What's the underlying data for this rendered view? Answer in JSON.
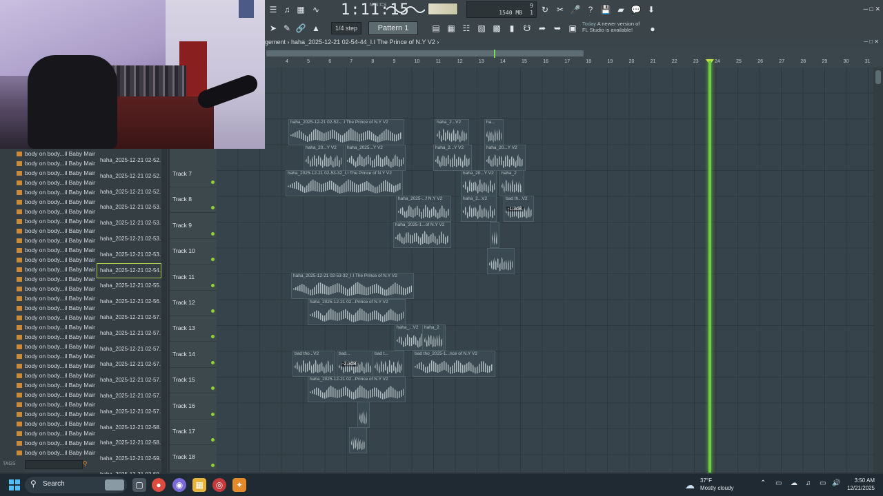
{
  "toolbar": {
    "time": "1:11:15",
    "time_unit": "M:S:CS",
    "cpu_value": "9",
    "memory": "1540 MB",
    "cpu_count": "1",
    "snap": "1/4 step",
    "pattern": "Pattern 1",
    "news_date": "Today",
    "news_text": "A newer version of FL Studio is available!"
  },
  "breadcrumb": "gement › haha_2025-12-21 02-54-44_I.I The Prince of N.Y V2 ›",
  "ruler": {
    "bars": [
      "4",
      "5",
      "6",
      "7",
      "8",
      "9",
      "10",
      "11",
      "12",
      "13",
      "14",
      "15",
      "16",
      "17",
      "18",
      "19",
      "20",
      "21",
      "22",
      "23",
      "24",
      "25",
      "26",
      "27",
      "28",
      "29",
      "30",
      "31"
    ]
  },
  "browser": {
    "left_items": [
      "body on body...il Baby Main",
      "body on body...il Baby Main",
      "body on body...il Baby Main",
      "body on body...il Baby Main",
      "body on body...il Baby Main",
      "body on body...il Baby Main",
      "body on body...il Baby Main",
      "body on body...il Baby Main",
      "body on body...il Baby Main",
      "body on body...il Baby Main",
      "body on body...il Baby Main",
      "body on body...il Baby Main",
      "body on body...il Baby Main",
      "body on body...il Baby Main",
      "body on body...il Baby Main",
      "body on body...il Baby Main",
      "body on body...il Baby Main",
      "body on body...il Baby Main",
      "body on body...il Baby Main",
      "body on body...il Baby Main",
      "body on body...il Baby Main",
      "body on body...il Baby Main",
      "body on body...il Baby Main",
      "body on body...il Baby Main",
      "body on body...il Baby Main",
      "body on body...il Baby Main",
      "body on body...il Baby Main",
      "body on body...il Baby Main",
      "body on body...il Baby Main",
      "body on body...il Baby Main",
      "body on body...il Baby Main",
      "body on body...il Baby Main"
    ],
    "right_items": [
      "haha_2025-12-21 02-52...",
      "haha_2025-12-21 02-52...",
      "haha_2025-12-21 02-52...",
      "haha_2025-12-21 02-53...",
      "haha_2025-12-21 02-53...",
      "haha_2025-12-21 02-53...",
      "haha_2025-12-21 02-53...",
      "haha_2025-12-21 02-54...",
      "haha_2025-12-21 02-55...",
      "haha_2025-12-21 02-56...",
      "haha_2025-12-21 02-57...",
      "haha_2025-12-21 02-57...",
      "haha_2025-12-21 02-57...",
      "haha_2025-12-21 02-57...",
      "haha_2025-12-21 02-57...",
      "haha_2025-12-21 02-57...",
      "haha_2025-12-21 02-57...",
      "haha_2025-12-21 02-58...",
      "haha_2025-12-21 02-58...",
      "haha_2025-12-21 02-59...",
      "haha_2025-12-21 02-59..."
    ],
    "tags_label": "TAGS"
  },
  "tracks": [
    "Track 7",
    "Track 8",
    "Track 9",
    "Track 10",
    "Track 11",
    "Track 12",
    "Track 13",
    "Track 14",
    "Track 15",
    "Track 16",
    "Track 17",
    "Track 18"
  ],
  "clips": [
    {
      "label": "haha_2025-12-21 02-52-...I The Prince of N.Y V2"
    },
    {
      "label": "haha_2...V2"
    },
    {
      "label": "ha..."
    },
    {
      "label": "haha_20...Y V2"
    },
    {
      "label": "haha_2025...Y V2"
    },
    {
      "label": "haha_2...Y V2"
    },
    {
      "label": "haha_20...Y V2"
    },
    {
      "label": "haha_2025-12-21 02-53-32_I.I The Prince of N.Y V2"
    },
    {
      "label": "haha_20...Y V2"
    },
    {
      "label": "haha_2"
    },
    {
      "label": "haha_2025-...f N.Y V2"
    },
    {
      "label": "haha_2...V2"
    },
    {
      "label": "bad th...V2"
    },
    {
      "label": "haha_2025-1...of N.Y V2"
    },
    {
      "label": ""
    },
    {
      "label": ""
    },
    {
      "label": "haha_2025-12-21 02-53-32_I.I The Prince of N.Y V2"
    },
    {
      "label": "haha_2025-12-21 02...Prince of N.Y V2"
    },
    {
      "label": "haha_...V2"
    },
    {
      "label": "haha_2"
    },
    {
      "label": "bad tho...V2"
    },
    {
      "label": "bad..."
    },
    {
      "label": "bad t..."
    },
    {
      "label": "bad tho_2025-1...nce of N.Y V2"
    },
    {
      "label": "haha_2025-12-21 02...Prince of N.Y V2"
    },
    {
      "label": ""
    },
    {
      "label": ""
    }
  ],
  "gains": [
    "-1.3dB",
    "-2.3dB"
  ],
  "taskbar": {
    "search": "Search",
    "temp": "37°F",
    "weather": "Mostly cloudy",
    "time": "3:50 AM",
    "date": "12/21/2025"
  },
  "colors": {
    "accent_green": "#6fcf3f",
    "background": "#36434a"
  }
}
